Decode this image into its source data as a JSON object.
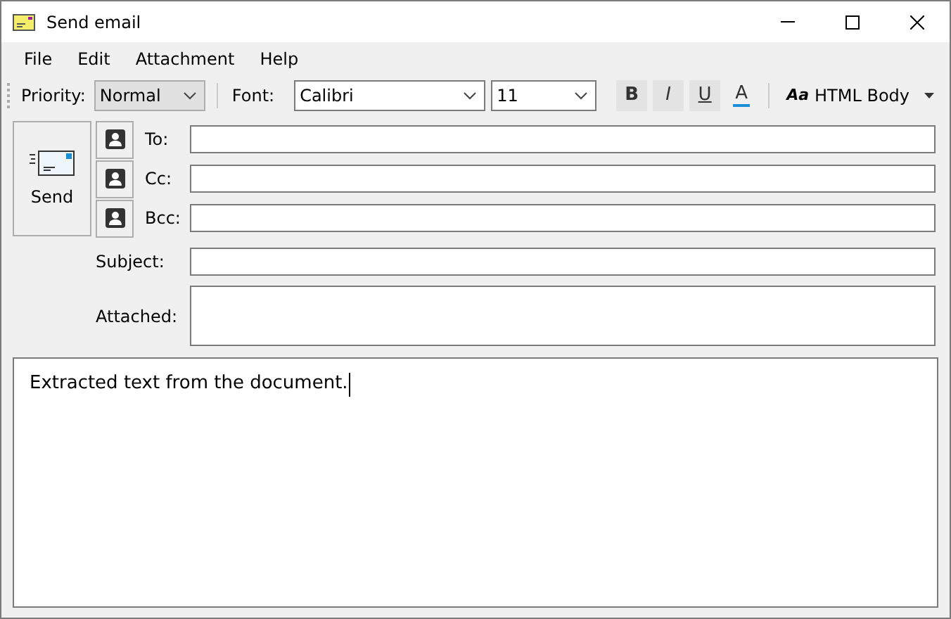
{
  "window": {
    "title": "Send email"
  },
  "menu": [
    "File",
    "Edit",
    "Attachment",
    "Help"
  ],
  "toolbar": {
    "priority_label": "Priority:",
    "priority": "Normal",
    "font_label": "Font:",
    "font": "Calibri",
    "size": "11",
    "format_buttons": [
      {
        "kind": "bold",
        "label": "B"
      },
      {
        "kind": "italic",
        "label": "I"
      },
      {
        "kind": "underline",
        "label": "U"
      },
      {
        "kind": "color",
        "label": "A"
      }
    ],
    "body_format_icon": "Aa",
    "body_format": "HTML Body"
  },
  "send_button": "Send",
  "recipients": [
    {
      "label": "To:"
    },
    {
      "label": "Cc:"
    },
    {
      "label": "Bcc:"
    }
  ],
  "subject": {
    "label": "Subject:"
  },
  "attached": {
    "label": "Attached:"
  },
  "body": {
    "value": "Extracted text from the document."
  }
}
